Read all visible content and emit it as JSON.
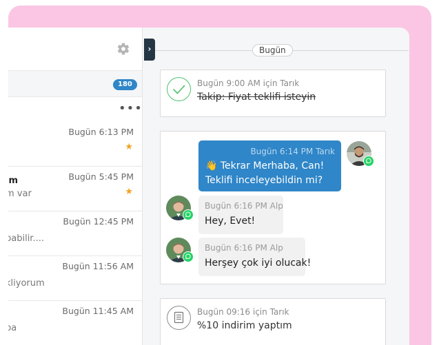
{
  "counts": {
    "badge": "180"
  },
  "day_separator": "Bugün",
  "conversations": [
    {
      "name": "",
      "preview": "",
      "time": "Bugün 6:13 PM",
      "starred": true
    },
    {
      "name": "ım",
      "preview": "m var",
      "time": "Bugün 5:45 PM",
      "starred": true
    },
    {
      "name": "",
      "preview": "pabilir....",
      "time": "Bugün 12:45 PM",
      "starred": false
    },
    {
      "name": "",
      "preview": "kliyorum",
      "time": "Bugün 11:56 AM",
      "starred": false
    },
    {
      "name": "",
      "preview": "ba",
      "time": "Bugün 11:45 AM",
      "starred": false
    }
  ],
  "task": {
    "meta": "Bugün  9:00 AM  için Tarık",
    "title": "Takip: Fiyat teklifi isteyin"
  },
  "chat": {
    "outgoing": {
      "meta": "Bugün 6:14 PM Tarık",
      "line1": "👋 Tekrar Merhaba, Can!",
      "line2": "Teklifi inceleyebildin mi?"
    },
    "incoming": [
      {
        "meta": "Bugün 6:16 PM Alp",
        "text": "Hey, Evet!"
      },
      {
        "meta": "Bugün 6:16 PM Alp",
        "text": "Herşey çok iyi olucak!"
      }
    ]
  },
  "note": {
    "meta": "Bugün  09:16  için Tarık",
    "title": "%10 indirim yaptım"
  },
  "icons": {
    "settings": "gear-icon",
    "more": "more-horizontal-icon",
    "star": "star-icon",
    "toggle": "chevron-right-icon",
    "task": "check-circle-icon",
    "note": "document-icon",
    "whatsapp": "whatsapp-icon"
  },
  "colors": {
    "accent": "#2f86c8",
    "star": "#f3a325",
    "success": "#4cbf6b",
    "whatsapp": "#25d366",
    "toggle": "#253645",
    "background": "#fbc6e4"
  }
}
